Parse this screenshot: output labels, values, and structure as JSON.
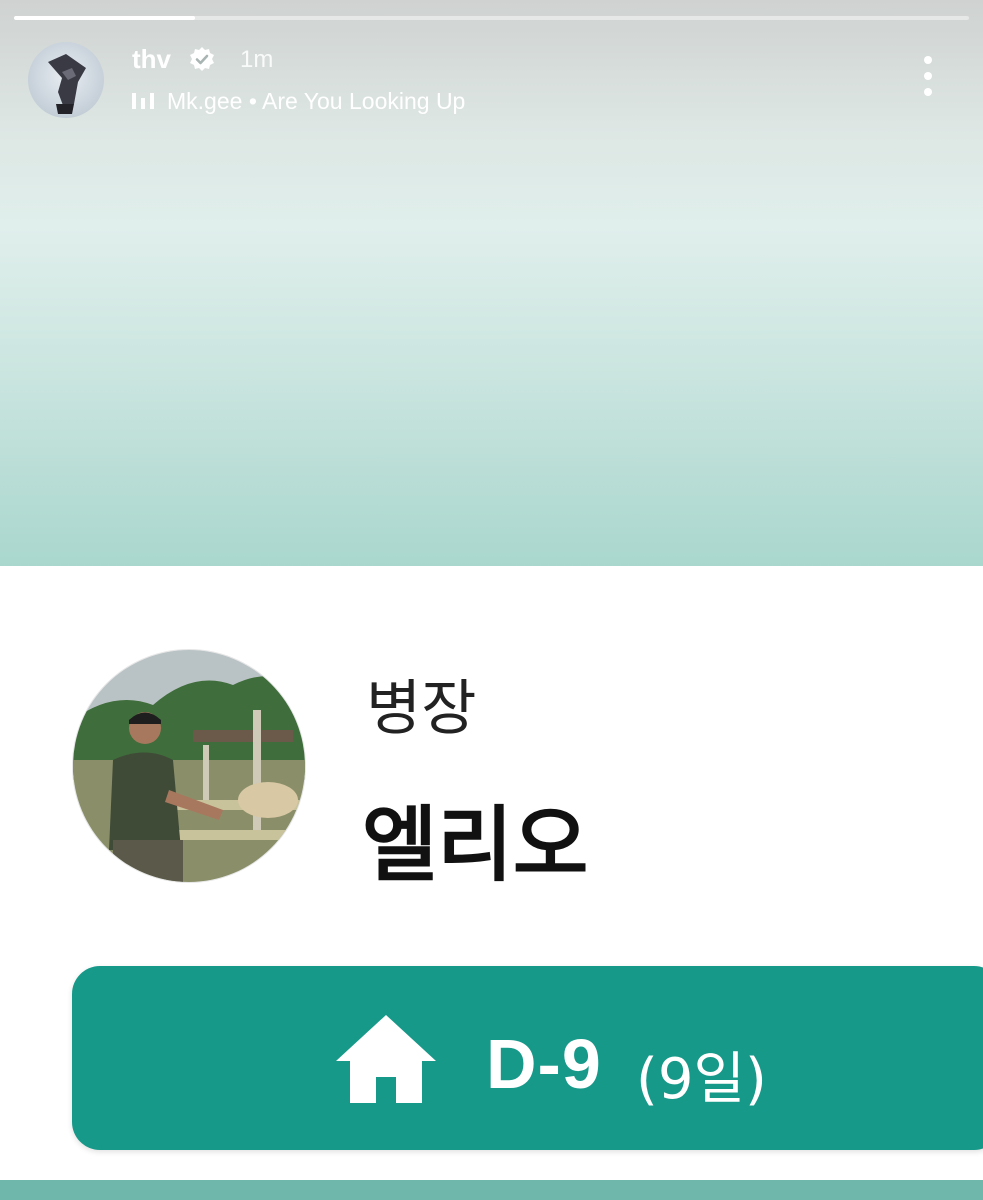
{
  "story": {
    "progress": 0.19,
    "username": "thv",
    "verified": true,
    "timestamp": "1m",
    "music": {
      "artist": "Mk.gee",
      "separator": "•",
      "song": "Are You Looking Up"
    },
    "more_icon": "more-vertical-icon"
  },
  "card": {
    "rank": "병장",
    "name": "엘리오",
    "dday": {
      "label": "D-9",
      "days": "(9일)",
      "icon": "home-icon"
    }
  },
  "colors": {
    "accent": "#17998a",
    "strip": "#6fb7ab"
  }
}
